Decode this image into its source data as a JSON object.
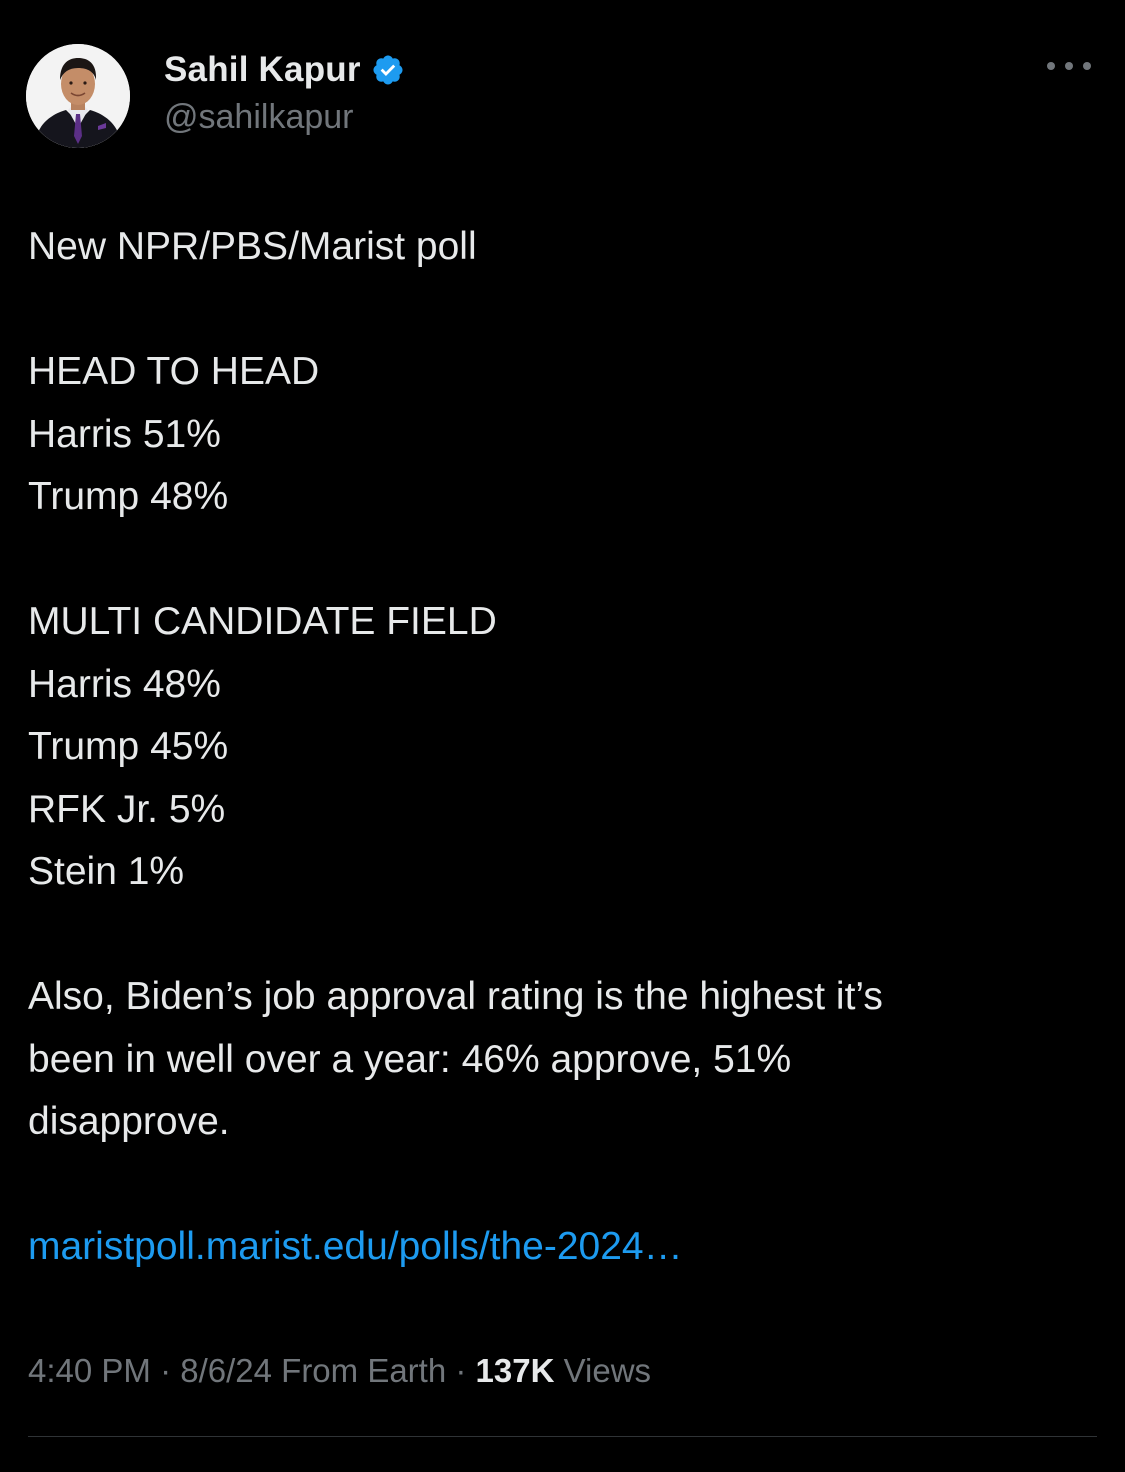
{
  "colors": {
    "background": "#000000",
    "text": "#e7e9ea",
    "muted": "#71767b",
    "link": "#1d9bf0",
    "verified": "#1d9bf0",
    "divider": "#2f3336"
  },
  "author": {
    "display_name": "Sahil Kapur",
    "handle": "@sahilkapur",
    "verified_icon": "verified-badge-icon",
    "avatar_icon": "profile-photo"
  },
  "more_icon": "more-options-icon",
  "tweet": {
    "intro": "New NPR/PBS/Marist poll",
    "head_to_head": {
      "heading": "HEAD TO HEAD",
      "rows": [
        "Harris 51%",
        "Trump 48%"
      ]
    },
    "multi_candidate": {
      "heading": "MULTI CANDIDATE FIELD",
      "rows": [
        "Harris 48%",
        "Trump 45%",
        "RFK Jr. 5%",
        "Stein 1%"
      ]
    },
    "approval": [
      "Also, Biden’s job approval rating is the highest it’s",
      "been in well over a year: 46% approve, 51%",
      "disapprove."
    ],
    "link_text": "maristpoll.marist.edu/polls/the-2024…"
  },
  "meta": {
    "time": "4:40 PM",
    "separator": " · ",
    "date": "8/6/24",
    "source": "From Earth",
    "views_count": "137K",
    "views_label": "Views"
  }
}
